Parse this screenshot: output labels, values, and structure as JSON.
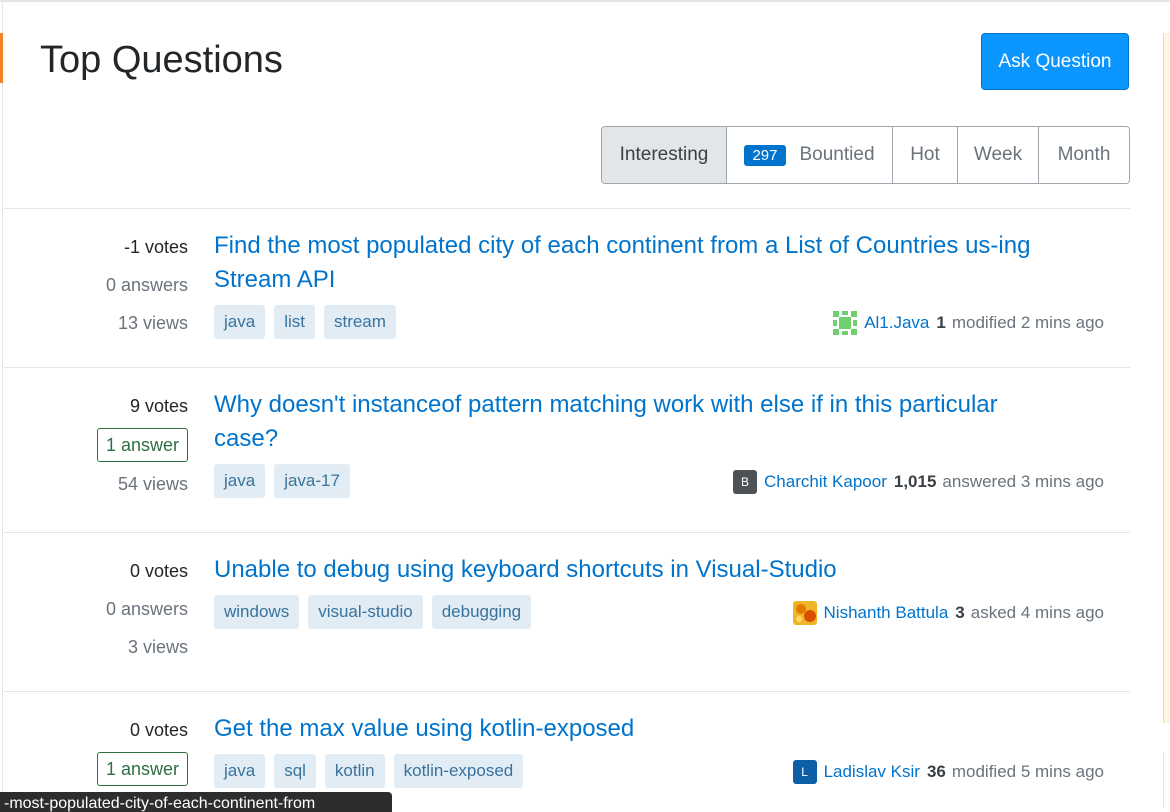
{
  "page": {
    "title": "Top Questions",
    "ask_button": "Ask Question"
  },
  "filters": {
    "interesting": "Interesting",
    "bountied_count": "297",
    "bountied": "Bountied",
    "hot": "Hot",
    "week": "Week",
    "month": "Month"
  },
  "questions": [
    {
      "votes": "-1 votes",
      "answers": "0 answers",
      "views": "13 views",
      "title": "Find the most populated city of each continent from a List of Countries us-ing Stream API",
      "tags": [
        "java",
        "list",
        "stream"
      ],
      "user": "Al1.Java",
      "rep": "1",
      "action": "modified 2 mins ago",
      "avatar_color": "#6fcf6f"
    },
    {
      "votes": "9 votes",
      "answers": "1 answer",
      "views": "54 views",
      "title": "Why doesn't instanceof pattern matching work with else if in this particular case?",
      "tags": [
        "java",
        "java-17"
      ],
      "user": "Charchit Kapoor",
      "rep": "1,015",
      "action": "answered 3 mins ago",
      "avatar_letter": "B",
      "avatar_color": "#4d5257"
    },
    {
      "votes": "0 votes",
      "answers": "0 answers",
      "views": "3 views",
      "title": "Unable to debug using keyboard shortcuts in Visual-Studio",
      "tags": [
        "windows",
        "visual-studio",
        "debugging"
      ],
      "user": "Nishanth Battula",
      "rep": "3",
      "action": "asked 4 mins ago",
      "avatar_color": "#e8a317"
    },
    {
      "votes": "0 votes",
      "answers": "1 answer",
      "title": "Get the max value using kotlin-exposed",
      "tags": [
        "java",
        "sql",
        "kotlin",
        "kotlin-exposed"
      ],
      "user": "Ladislav Ksir",
      "rep": "36",
      "action": "modified 5 mins ago",
      "avatar_letter": "L",
      "avatar_color": "#0d5fa8"
    }
  ],
  "status_bar": {
    "url_fragment": "-most-populated-city-of-each-continent-from"
  }
}
